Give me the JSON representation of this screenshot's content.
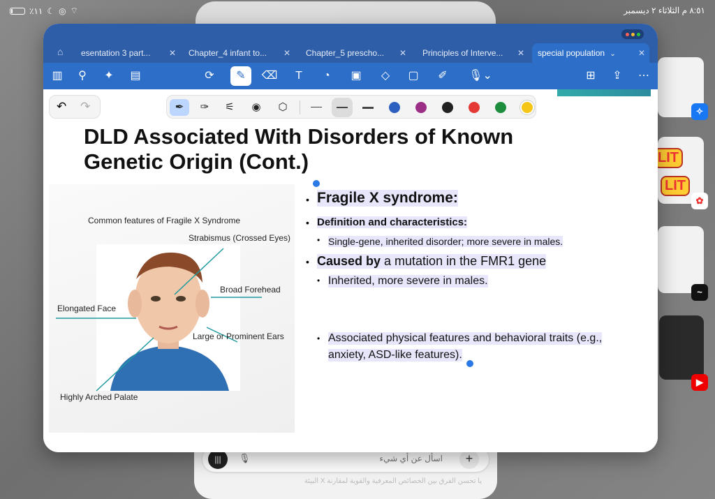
{
  "status_bar": {
    "battery": "٪١١",
    "time_date": "٨:٥١ م   الثلاثاء ٢ ديسمبر"
  },
  "tabs": [
    {
      "label": "esentation 3 part...",
      "active": false
    },
    {
      "label": "Chapter_4 infant to...",
      "active": false
    },
    {
      "label": "Chapter_5 prescho...",
      "active": false
    },
    {
      "label": "Principles of Interve...",
      "active": false
    },
    {
      "label": "special population",
      "active": true
    }
  ],
  "toolbar": {
    "icons": [
      "sidebar-icon",
      "search-icon",
      "ai-sparkle-icon",
      "notes-icon",
      "lasso-icon",
      "pen-icon",
      "eraser-icon",
      "text-box-icon",
      "sticker-icon",
      "image-icon",
      "shapes-icon",
      "sticky-note-icon",
      "highlighter-icon",
      "mic-icon",
      "add-page-icon",
      "share-icon",
      "more-icon"
    ]
  },
  "pen_bar": {
    "colors": [
      "#2c5fbf",
      "#9b2f86",
      "#222222",
      "#e53935",
      "#1e8e3e",
      "#f5c518"
    ],
    "selected_color_index": 5
  },
  "slide": {
    "title_line1": "DLD Associated With Disorders of Known",
    "title_line2": "Genetic Origin (Cont.)",
    "figure": {
      "title": "Common features of Fragile X Syndrome",
      "labels": {
        "strabismus": "Strabismus (Crossed Eyes)",
        "forehead": "Broad Forehead",
        "face": "Elongated Face",
        "ears": "Large or Prominent Ears",
        "palate": "Highly Arched Palate"
      }
    },
    "bullets": {
      "b1": "Fragile X syndrome:",
      "b2": "Definition and characteristics:",
      "b3": "Single-gene, inherited disorder; more severe in males.",
      "b4_bold": "Caused by",
      "b4_rest": " a mutation in the FMR1 gene",
      "b5": "Inherited, more severe in males.",
      "b6_line1": "Associated physical features and behavioral traits (e.g.,",
      "b6_line2": "anxiety, ASD-like features)."
    }
  },
  "chat": {
    "placeholder": "اسأل عن أي شيء",
    "faded_text": "يا تحسن الفرق بين الخصائص المعرفية والقوية لمقارنة X البيئة"
  },
  "stickers": [
    "LIT",
    "LIT"
  ]
}
